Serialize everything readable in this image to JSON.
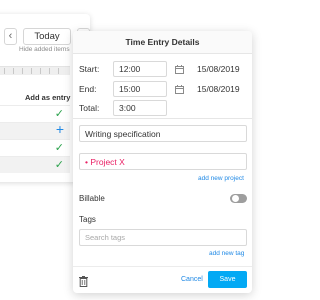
{
  "background_panel": {
    "prev_icon": "chevron-left",
    "next_icon": "chevron-right",
    "today_label": "Today",
    "hide_added_label": "Hide added items",
    "add_as_entry_label": "Add as entry",
    "rows": [
      {
        "icon": "check-icon"
      },
      {
        "icon": "plus-icon"
      },
      {
        "icon": "check-icon"
      },
      {
        "icon": "check-icon"
      }
    ]
  },
  "dialog": {
    "title": "Time Entry Details",
    "start_label": "Start:",
    "start_time": "12:00",
    "start_date": "15/08/2019",
    "end_label": "End:",
    "end_time": "15:00",
    "end_date": "15/08/2019",
    "total_label": "Total:",
    "total_value": "3:00",
    "description": "Writing specification",
    "project": "• Project X",
    "add_project_label": "add new project",
    "billable_label": "Billable",
    "billable_on": false,
    "tags_label": "Tags",
    "tags_placeholder": "Search tags",
    "add_tag_label": "add new tag",
    "cancel_label": "Cancel",
    "save_label": "Save"
  },
  "colors": {
    "accent": "#03a9f4",
    "link": "#1e88e5",
    "project": "#e91e63",
    "check": "#2ba24c"
  }
}
